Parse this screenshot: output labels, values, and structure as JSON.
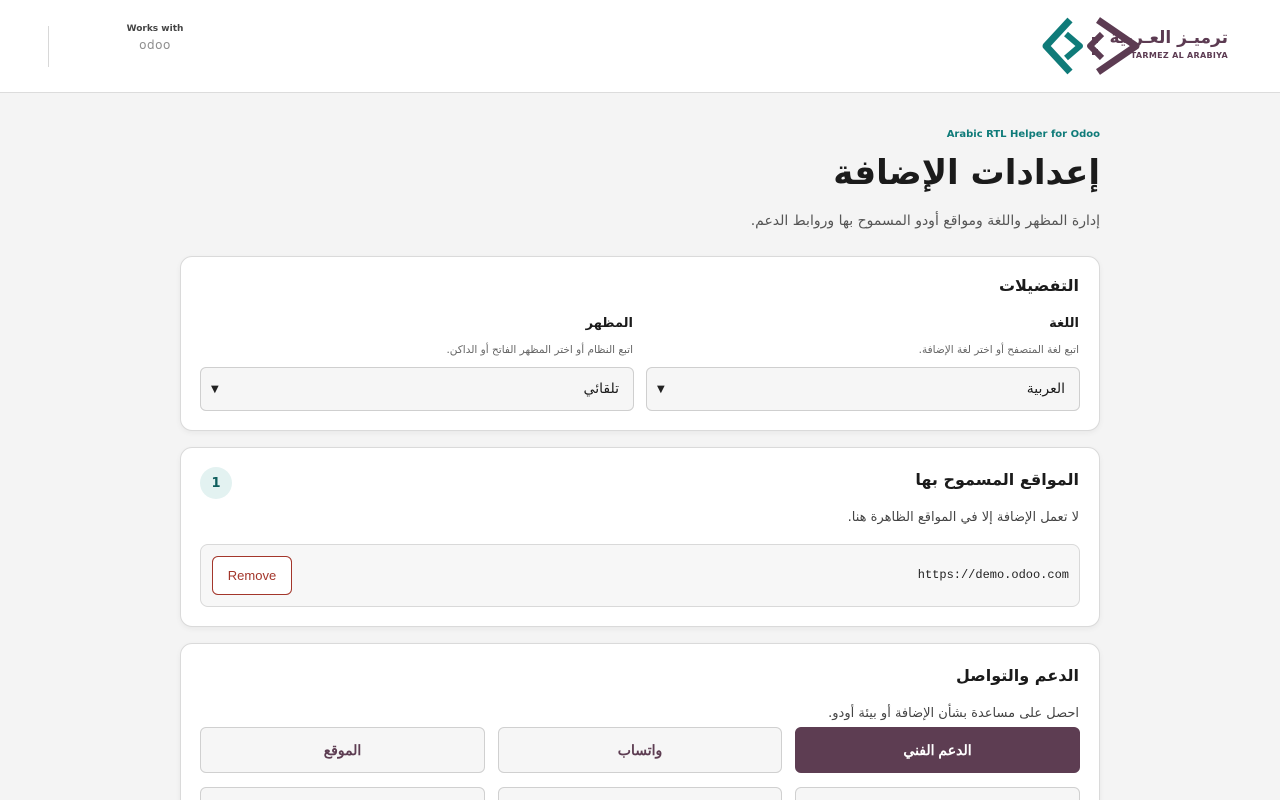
{
  "header": {
    "works_with_label": "Works with",
    "odoo_wordmark": "odoo",
    "brand": {
      "name_ar": "ترميـز العـربية",
      "name_en": "TARMEZ AL ARABIYA",
      "colors": {
        "teal": "#0f7b79",
        "plum": "#5c3b52"
      }
    }
  },
  "page": {
    "eyebrow": "Arabic RTL Helper for Odoo",
    "title": "إعدادات الإضافة",
    "subtitle": "إدارة المظهر واللغة ومواقع أودو المسموح بها وروابط الدعم."
  },
  "preferences": {
    "title": "التفضيلات",
    "language": {
      "label": "اللغة",
      "help": "اتبع لغة المتصفح أو اختر لغة الإضافة.",
      "value": "العربية"
    },
    "theme": {
      "label": "المظهر",
      "help": "اتبع النظام أو اختر المظهر الفاتح أو الداكن.",
      "value": "تلقائي"
    }
  },
  "allowed_sites": {
    "title": "المواقع المسموح بها",
    "count": "1",
    "description": "لا تعمل الإضافة إلا في المواقع الظاهرة هنا.",
    "sites": [
      {
        "url": "https://demo.odoo.com",
        "remove_label": "Remove"
      }
    ]
  },
  "support": {
    "title": "الدعم والتواصل",
    "description": "احصل على مساعدة بشأن الإضافة أو بيئة أودو.",
    "buttons": [
      "الدعم الفني",
      "واتساب",
      "الموقع"
    ]
  },
  "colors": {
    "accent_teal": "#0f7b79",
    "primary_plum": "#5d3d52",
    "danger": "#a3362b"
  }
}
